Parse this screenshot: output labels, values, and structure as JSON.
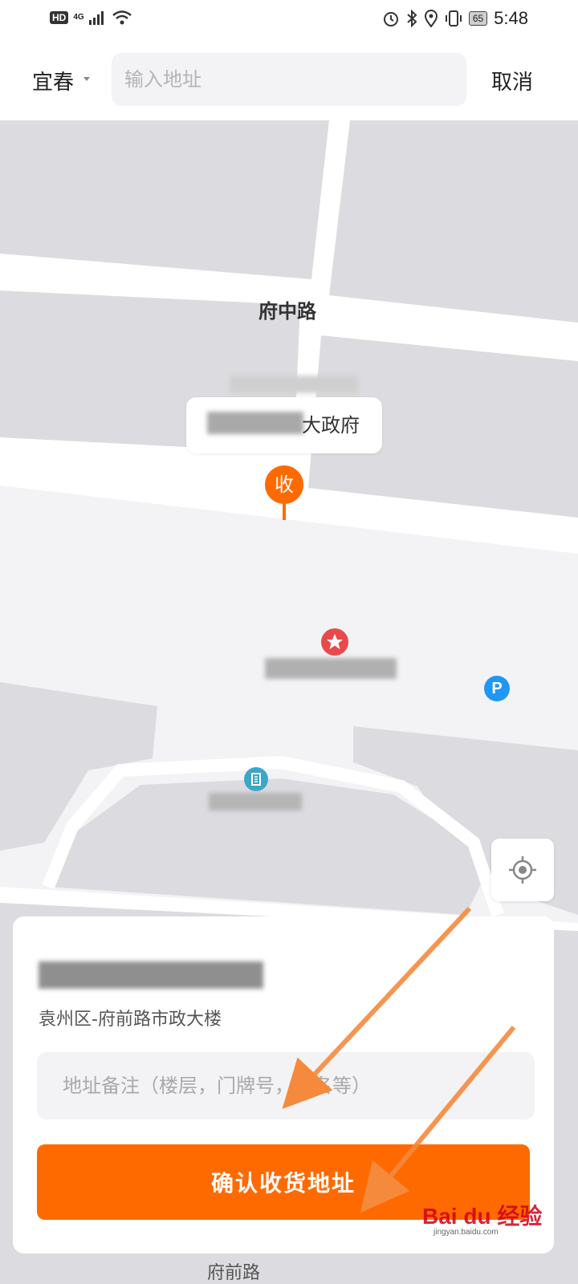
{
  "status_bar": {
    "left_badge": "HD",
    "network_type": "4G",
    "battery": "65",
    "time": "5:48",
    "icons": [
      "hd-icon",
      "signal-icon",
      "wifi-icon",
      "alarm-icon",
      "bluetooth-icon",
      "location-icon",
      "vibrate-icon",
      "battery-icon"
    ]
  },
  "header": {
    "city": "宜春",
    "search_placeholder": "输入地址",
    "cancel_label": "取消"
  },
  "map": {
    "road_label": "府中路",
    "callout_title_suffix": "大政府",
    "marker_label": "收",
    "poi_icons": [
      "star-poi-icon",
      "parking-icon",
      "building-poi-icon"
    ],
    "parking_label": "P",
    "locate_icon": "crosshair-icon",
    "bottom_road_label": "府前路",
    "colors": {
      "map_bg": "#f3f3f5",
      "block": "#dcdce0",
      "road": "#ffffff",
      "accent": "#ff6a00",
      "star_poi": "#e84a4a",
      "parking": "#2196f3",
      "building_poi": "#3aa7c8"
    }
  },
  "panel": {
    "place_address": "袁州区-府前路市政大楼",
    "note_placeholder": "地址备注（楼层，门牌号，店名等）",
    "confirm_label": "确认收货地址"
  },
  "watermark": {
    "brand": "Bai du 经验",
    "url": "jingyan.baidu.com"
  }
}
